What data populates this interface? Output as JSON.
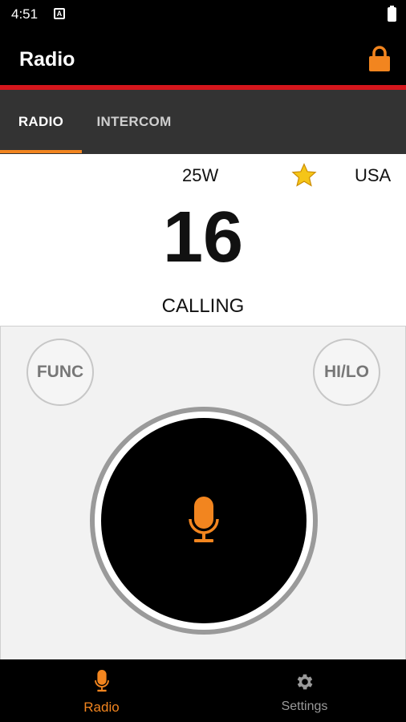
{
  "status_bar": {
    "time": "4:51",
    "notification": "A"
  },
  "app_bar": {
    "title": "Radio",
    "lock_icon": "lock-icon"
  },
  "tabs": [
    {
      "label": "RADIO",
      "selected": true
    },
    {
      "label": "INTERCOM",
      "selected": false
    }
  ],
  "channel": {
    "power": "25W",
    "favorite_icon": "star-icon",
    "region": "USA",
    "number": "16",
    "name": "CALLING"
  },
  "controls": {
    "func_label": "FUNC",
    "hilo_label": "HI/LO",
    "ptt_icon": "microphone-icon"
  },
  "bottom_nav": [
    {
      "label": "Radio",
      "icon": "microphone-icon",
      "selected": true
    },
    {
      "label": "Settings",
      "icon": "gear-icon",
      "selected": false
    }
  ],
  "colors": {
    "accent": "#f2851f",
    "divider_red": "#d4161c",
    "tab_bar": "#333333",
    "star": "#f5c518"
  }
}
